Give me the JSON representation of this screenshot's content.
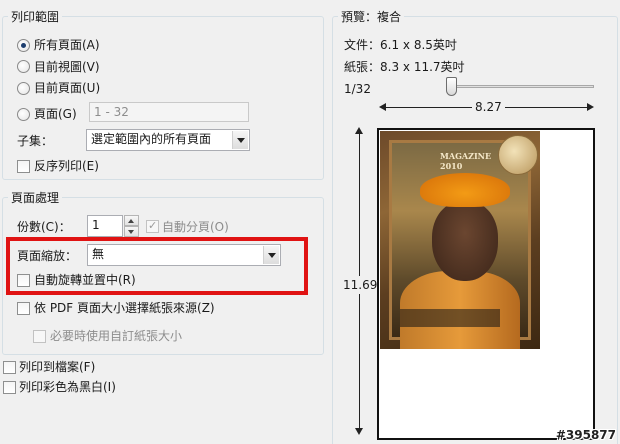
{
  "print_range": {
    "title": "列印範圍",
    "all_pages": "所有頁面(A)",
    "current_view": "目前視圖(V)",
    "current_page": "目前頁面(U)",
    "pages": "頁面(G)",
    "pages_value": "1 - 32",
    "subset_label": "子集：",
    "subset_value": "選定範圍內的所有頁面",
    "reverse_pages": "反序列印(E)"
  },
  "page_handling": {
    "title": "頁面處理",
    "copies_label": "份數(C)：",
    "copies_value": "1",
    "collate": "自動分頁(O)",
    "scaling_label": "頁面縮放：",
    "scaling_value": "無",
    "auto_rotate": "自動旋轉並置中(R)",
    "choose_paper_source": "依 PDF 頁面大小選擇紙張來源(Z)",
    "custom_paper": "必要時使用自訂紙張大小"
  },
  "print_to_file": "列印到檔案(F)",
  "print_grayscale": "列印彩色為黑白(I)",
  "preview": {
    "title": "預覽：複合",
    "document_size": "文件：6.1 x 8.5英吋",
    "paper_size": "紙張：8.3 x 11.7英吋",
    "page_counter": "1/32",
    "slider_position_fraction": 0.0,
    "width_dim": "8.27",
    "height_dim": "11.69"
  },
  "magazine": {
    "title": "MAGAZINE",
    "year": "2010"
  },
  "watermark": "#395877",
  "colors": {
    "highlight": "#e01313",
    "group_border": "#d5dfe5",
    "dialog_bg": "#f0f0f0"
  }
}
